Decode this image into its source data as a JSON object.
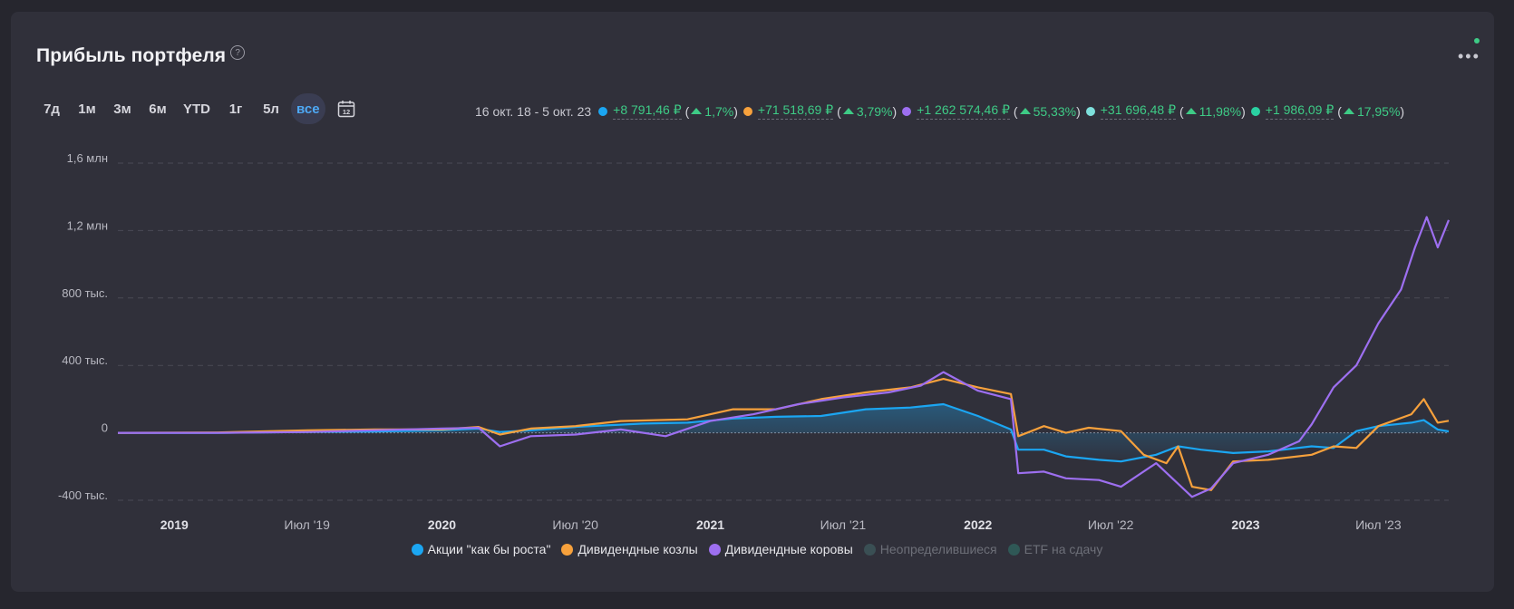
{
  "title": "Прибыль портфеля",
  "help_glyph": "?",
  "periods": [
    "7д",
    "1м",
    "3м",
    "6м",
    "YTD",
    "1г",
    "5л",
    "все"
  ],
  "active_period": "все",
  "calendar_day": "12",
  "date_range": "16 окт. 18 - 5 окт. 23",
  "summary": [
    {
      "color": "#1ba6f2",
      "value": "+8 791,46 ₽",
      "pct": "1,7%"
    },
    {
      "color": "#f7a13c",
      "value": "+71 518,69 ₽",
      "pct": "3,79%"
    },
    {
      "color": "#9d6ff0",
      "value": "+1 262 574,46 ₽",
      "pct": "55,33%"
    },
    {
      "color": "#7ee0dc",
      "value": "+31 696,48 ₽",
      "pct": "11,98%"
    },
    {
      "color": "#2ad1a2",
      "value": "+1 986,09 ₽",
      "pct": "17,95%"
    }
  ],
  "chart_data": {
    "type": "line",
    "x_range": [
      "2018-10-16",
      "2023-10-05"
    ],
    "ylim": [
      -400000,
      1600000
    ],
    "y_ticks": [
      {
        "value": 1600000,
        "label": "1,6 млн"
      },
      {
        "value": 1200000,
        "label": "1,2 млн"
      },
      {
        "value": 800000,
        "label": "800 тыс."
      },
      {
        "value": 400000,
        "label": "400 тыс."
      },
      {
        "value": 0,
        "label": "0"
      },
      {
        "value": -400000,
        "label": "-400 тыс."
      }
    ],
    "x_ticks": [
      {
        "date": "2019-01-01",
        "label": "2019",
        "year": true
      },
      {
        "date": "2019-07-01",
        "label": "Июл '19",
        "year": false
      },
      {
        "date": "2020-01-01",
        "label": "2020",
        "year": true
      },
      {
        "date": "2020-07-01",
        "label": "Июл '20",
        "year": false
      },
      {
        "date": "2021-01-01",
        "label": "2021",
        "year": true
      },
      {
        "date": "2021-07-01",
        "label": "Июл '21",
        "year": false
      },
      {
        "date": "2022-01-01",
        "label": "2022",
        "year": true
      },
      {
        "date": "2022-07-01",
        "label": "Июл '22",
        "year": false
      },
      {
        "date": "2023-01-01",
        "label": "2023",
        "year": true
      },
      {
        "date": "2023-07-01",
        "label": "Июл '23",
        "year": false
      }
    ],
    "grid": "horizontal dashed",
    "legend_position": "bottom",
    "series": [
      {
        "name": "Акции \"как бы роста\"",
        "color": "#1ba6f2",
        "visible": true,
        "area_fill": true,
        "points": [
          [
            "2018-10-16",
            0
          ],
          [
            "2019-03-01",
            0
          ],
          [
            "2019-07-01",
            5000
          ],
          [
            "2019-10-01",
            8000
          ],
          [
            "2020-01-01",
            15000
          ],
          [
            "2020-02-20",
            25000
          ],
          [
            "2020-03-20",
            5000
          ],
          [
            "2020-05-01",
            15000
          ],
          [
            "2020-07-01",
            35000
          ],
          [
            "2020-10-01",
            55000
          ],
          [
            "2020-12-01",
            60000
          ],
          [
            "2021-02-01",
            85000
          ],
          [
            "2021-04-01",
            95000
          ],
          [
            "2021-06-01",
            100000
          ],
          [
            "2021-08-01",
            140000
          ],
          [
            "2021-10-01",
            150000
          ],
          [
            "2021-11-15",
            170000
          ],
          [
            "2022-01-01",
            100000
          ],
          [
            "2022-02-15",
            20000
          ],
          [
            "2022-02-25",
            -100000
          ],
          [
            "2022-04-01",
            -100000
          ],
          [
            "2022-05-01",
            -140000
          ],
          [
            "2022-06-15",
            -160000
          ],
          [
            "2022-07-15",
            -170000
          ],
          [
            "2022-09-01",
            -130000
          ],
          [
            "2022-10-01",
            -80000
          ],
          [
            "2022-11-01",
            -100000
          ],
          [
            "2022-12-15",
            -120000
          ],
          [
            "2023-02-01",
            -110000
          ],
          [
            "2023-04-01",
            -80000
          ],
          [
            "2023-05-01",
            -90000
          ],
          [
            "2023-06-01",
            10000
          ],
          [
            "2023-07-01",
            40000
          ],
          [
            "2023-08-15",
            60000
          ],
          [
            "2023-09-01",
            75000
          ],
          [
            "2023-09-20",
            20000
          ],
          [
            "2023-10-05",
            8791
          ]
        ]
      },
      {
        "name": "Дивидендные козлы",
        "color": "#f7a13c",
        "visible": true,
        "area_fill": false,
        "points": [
          [
            "2018-10-16",
            0
          ],
          [
            "2019-03-01",
            2000
          ],
          [
            "2019-07-01",
            15000
          ],
          [
            "2019-10-01",
            20000
          ],
          [
            "2020-01-01",
            20000
          ],
          [
            "2020-02-20",
            35000
          ],
          [
            "2020-03-20",
            -10000
          ],
          [
            "2020-05-01",
            25000
          ],
          [
            "2020-07-01",
            40000
          ],
          [
            "2020-09-01",
            70000
          ],
          [
            "2020-12-01",
            80000
          ],
          [
            "2021-02-01",
            140000
          ],
          [
            "2021-04-01",
            140000
          ],
          [
            "2021-06-01",
            200000
          ],
          [
            "2021-08-01",
            240000
          ],
          [
            "2021-10-01",
            270000
          ],
          [
            "2021-11-15",
            320000
          ],
          [
            "2022-01-01",
            270000
          ],
          [
            "2022-02-15",
            230000
          ],
          [
            "2022-02-25",
            -20000
          ],
          [
            "2022-04-01",
            40000
          ],
          [
            "2022-05-01",
            0
          ],
          [
            "2022-06-01",
            30000
          ],
          [
            "2022-07-15",
            10000
          ],
          [
            "2022-08-15",
            -130000
          ],
          [
            "2022-09-15",
            -180000
          ],
          [
            "2022-10-01",
            -80000
          ],
          [
            "2022-10-20",
            -320000
          ],
          [
            "2022-11-15",
            -340000
          ],
          [
            "2022-12-15",
            -170000
          ],
          [
            "2023-02-01",
            -160000
          ],
          [
            "2023-04-01",
            -130000
          ],
          [
            "2023-05-01",
            -80000
          ],
          [
            "2023-06-01",
            -90000
          ],
          [
            "2023-07-01",
            40000
          ],
          [
            "2023-08-15",
            110000
          ],
          [
            "2023-09-01",
            200000
          ],
          [
            "2023-09-20",
            60000
          ],
          [
            "2023-10-05",
            71518
          ]
        ]
      },
      {
        "name": "Дивидендные коровы",
        "color": "#9d6ff0",
        "visible": true,
        "area_fill": false,
        "points": [
          [
            "2018-10-16",
            0
          ],
          [
            "2019-03-01",
            0
          ],
          [
            "2019-07-01",
            5000
          ],
          [
            "2019-10-01",
            15000
          ],
          [
            "2020-01-01",
            25000
          ],
          [
            "2020-02-20",
            30000
          ],
          [
            "2020-03-20",
            -80000
          ],
          [
            "2020-05-01",
            -20000
          ],
          [
            "2020-07-01",
            -10000
          ],
          [
            "2020-09-01",
            20000
          ],
          [
            "2020-11-01",
            -20000
          ],
          [
            "2021-01-01",
            70000
          ],
          [
            "2021-03-01",
            110000
          ],
          [
            "2021-05-01",
            170000
          ],
          [
            "2021-07-01",
            210000
          ],
          [
            "2021-09-01",
            240000
          ],
          [
            "2021-10-15",
            280000
          ],
          [
            "2021-11-15",
            360000
          ],
          [
            "2022-01-01",
            250000
          ],
          [
            "2022-02-15",
            200000
          ],
          [
            "2022-02-25",
            -240000
          ],
          [
            "2022-04-01",
            -230000
          ],
          [
            "2022-05-01",
            -270000
          ],
          [
            "2022-06-15",
            -280000
          ],
          [
            "2022-07-15",
            -320000
          ],
          [
            "2022-09-01",
            -180000
          ],
          [
            "2022-10-20",
            -380000
          ],
          [
            "2022-11-15",
            -330000
          ],
          [
            "2022-12-15",
            -180000
          ],
          [
            "2023-02-01",
            -130000
          ],
          [
            "2023-03-15",
            -50000
          ],
          [
            "2023-04-01",
            50000
          ],
          [
            "2023-05-01",
            270000
          ],
          [
            "2023-06-01",
            400000
          ],
          [
            "2023-07-01",
            650000
          ],
          [
            "2023-08-01",
            850000
          ],
          [
            "2023-08-20",
            1100000
          ],
          [
            "2023-09-05",
            1280000
          ],
          [
            "2023-09-20",
            1100000
          ],
          [
            "2023-10-05",
            1262574
          ]
        ]
      },
      {
        "name": "Неопределившиеся",
        "color": "#3a4f54",
        "visible": false,
        "points": []
      },
      {
        "name": "ETF на сдачу",
        "color": "#2f5856",
        "visible": false,
        "points": []
      }
    ]
  }
}
